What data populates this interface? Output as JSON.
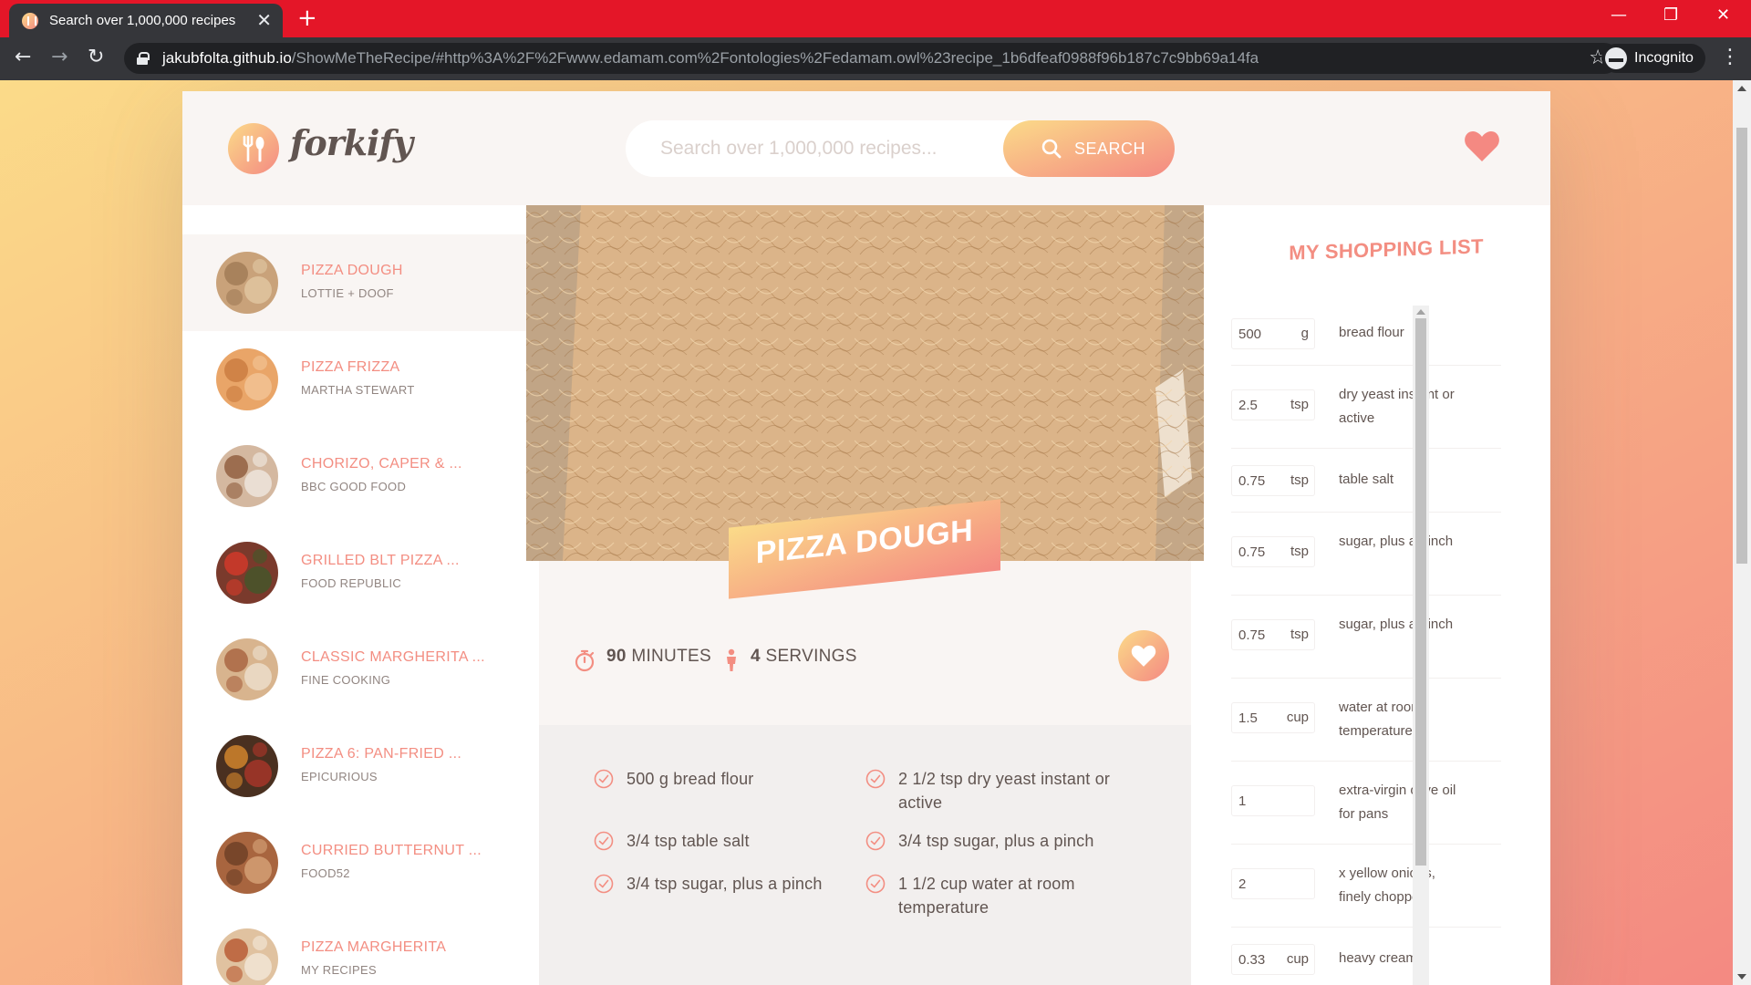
{
  "browser": {
    "tab_title": "Search over 1,000,000 recipes",
    "tab_close": "✕",
    "new_tab": "+",
    "url_host": "jakubfolta.github.io",
    "url_path": "/ShowMeTheRecipe/#http%3A%2F%2Fwww.edamam.com%2Fontologies%2Fedamam.owl%23recipe_1b6dfeaf0988f96b187c7c9bb69a14fa",
    "incognito_label": "Incognito",
    "minimize": "—",
    "restore": "❐",
    "close": "✕",
    "back": "←",
    "forward": "→",
    "reload": "↻",
    "star": "☆",
    "menu": "⋮"
  },
  "header": {
    "logo_text": "forkify",
    "search_placeholder": "Search over 1,000,000 recipes...",
    "search_button": "SEARCH"
  },
  "results": [
    {
      "title": "PIZZA DOUGH",
      "publisher": "LOTTIE + DOOF",
      "active": true,
      "colors": [
        "#c9a27a",
        "#a07a55",
        "#e3c9a5"
      ]
    },
    {
      "title": "PIZZA FRIZZA",
      "publisher": "MARTHA STEWART",
      "active": false,
      "colors": [
        "#e9a568",
        "#c97a3e",
        "#f3c79a"
      ]
    },
    {
      "title": "CHORIZO, CAPER & ...",
      "publisher": "BBC GOOD FOOD",
      "active": false,
      "colors": [
        "#d4b8a0",
        "#8d5a3b",
        "#f1ebe4"
      ]
    },
    {
      "title": "GRILLED BLT PIZZA ...",
      "publisher": "FOOD REPUBLIC",
      "active": false,
      "colors": [
        "#7a3a2c",
        "#d63a2a",
        "#3f5a2a"
      ]
    },
    {
      "title": "CLASSIC MARGHERITA ...",
      "publisher": "FINE COOKING",
      "active": false,
      "colors": [
        "#d8b48e",
        "#a8613e",
        "#efe3d2"
      ]
    },
    {
      "title": "PIZZA 6: PAN-FRIED ...",
      "publisher": "EPICURIOUS",
      "active": false,
      "colors": [
        "#4a3020",
        "#d8892d",
        "#b2362a"
      ]
    },
    {
      "title": "CURRIED BUTTERNUT ...",
      "publisher": "FOOD52",
      "active": false,
      "colors": [
        "#a8653f",
        "#6b3e25",
        "#d9a77c"
      ]
    },
    {
      "title": "PIZZA MARGHERITA",
      "publisher": "MY RECIPES",
      "active": false,
      "colors": [
        "#e0c2a0",
        "#b7562f",
        "#f4e9dc"
      ]
    }
  ],
  "recipe": {
    "title": "PIZZA DOUGH",
    "time_value": "90",
    "time_unit": "MINUTES",
    "servings_value": "4",
    "servings_unit": "SERVINGS",
    "ingredients": [
      "500 g bread flour",
      "2 1/2 tsp dry yeast instant or active",
      "3/4 tsp table salt",
      "3/4 tsp sugar, plus a pinch",
      "3/4 tsp sugar, plus a pinch",
      "1 1/2 cup water at room temperature"
    ]
  },
  "shopping": {
    "heading": "MY SHOPPING LIST",
    "items": [
      {
        "count": "500",
        "unit": "g",
        "desc": "bread flour"
      },
      {
        "count": "2.5",
        "unit": "tsp",
        "desc": "dry yeast instant or active"
      },
      {
        "count": "0.75",
        "unit": "tsp",
        "desc": "table salt"
      },
      {
        "count": "0.75",
        "unit": "tsp",
        "desc": "sugar, plus a pinch"
      },
      {
        "count": "0.75",
        "unit": "tsp",
        "desc": "sugar, plus a pinch"
      },
      {
        "count": "1.5",
        "unit": "cup",
        "desc": "water at room temperature"
      },
      {
        "count": "1",
        "unit": "",
        "desc": "extra-virgin olive oil for pans"
      },
      {
        "count": "2",
        "unit": "",
        "desc": "x yellow onions, finely chopped"
      },
      {
        "count": "0.33",
        "unit": "cup",
        "desc": "heavy cream"
      }
    ]
  },
  "colors": {
    "brand_start": "#fbdb89",
    "brand_end": "#f48982",
    "text": "#615551",
    "accent": "#f38e82"
  }
}
